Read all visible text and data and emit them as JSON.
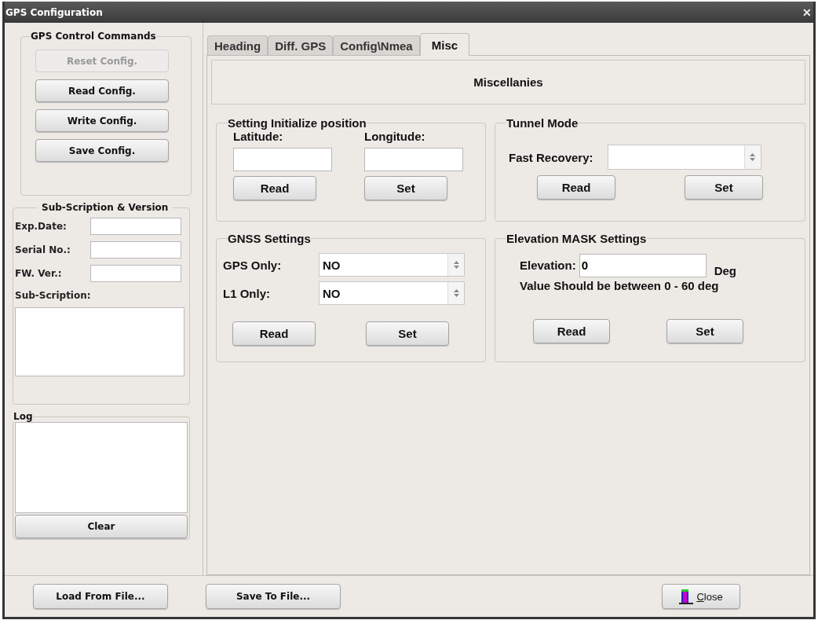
{
  "window": {
    "title": "GPS Configuration",
    "close_glyph": "✕"
  },
  "control_commands": {
    "title": "GPS Control Commands",
    "buttons": [
      {
        "label": "Reset Config.",
        "disabled": true
      },
      {
        "label": "Read Config.",
        "disabled": false
      },
      {
        "label": "Write Config.",
        "disabled": false
      },
      {
        "label": "Save Config.",
        "disabled": false
      }
    ]
  },
  "subscription": {
    "title": "Sub-Scription & Version",
    "fields": [
      {
        "label": "Exp.Date:"
      },
      {
        "label": "Serial No.:"
      },
      {
        "label": "FW. Ver.:"
      }
    ],
    "subscription_label": "Sub-Scription:"
  },
  "log": {
    "title": "Log",
    "clear_button": "Clear"
  },
  "tabs": [
    {
      "label": "Heading",
      "selected": false
    },
    {
      "label": "Diff. GPS",
      "selected": false
    },
    {
      "label": "Config\\Nmea",
      "selected": false
    },
    {
      "label": "Misc",
      "selected": true
    }
  ],
  "misc": {
    "heading": "Miscellanies",
    "init_position": {
      "title": "Setting Initialize position",
      "latitude_label": "Latitude:",
      "longitude_label": "Longitude:",
      "read_button": "Read",
      "set_button": "Set"
    },
    "tunnel_mode": {
      "title": "Tunnel Mode",
      "fast_recovery_label": "Fast Recovery:",
      "read_button": "Read",
      "set_button": "Set"
    },
    "gnss": {
      "title": "GNSS Settings",
      "rows": [
        {
          "label": "GPS Only:",
          "value": "NO"
        },
        {
          "label": "L1 Only:",
          "value": "NO"
        }
      ],
      "read_button": "Read",
      "set_button": "Set"
    },
    "elevation": {
      "title": "Elevation MASK Settings",
      "label": "Elevation:",
      "value": "0",
      "unit": "Deg",
      "hint": "Value Should be between 0 - 60 deg",
      "read_button": "Read",
      "set_button": "Set"
    }
  },
  "footer": {
    "load_button": "Load From File...",
    "save_button": "Save To File...",
    "close_button": "Close"
  }
}
